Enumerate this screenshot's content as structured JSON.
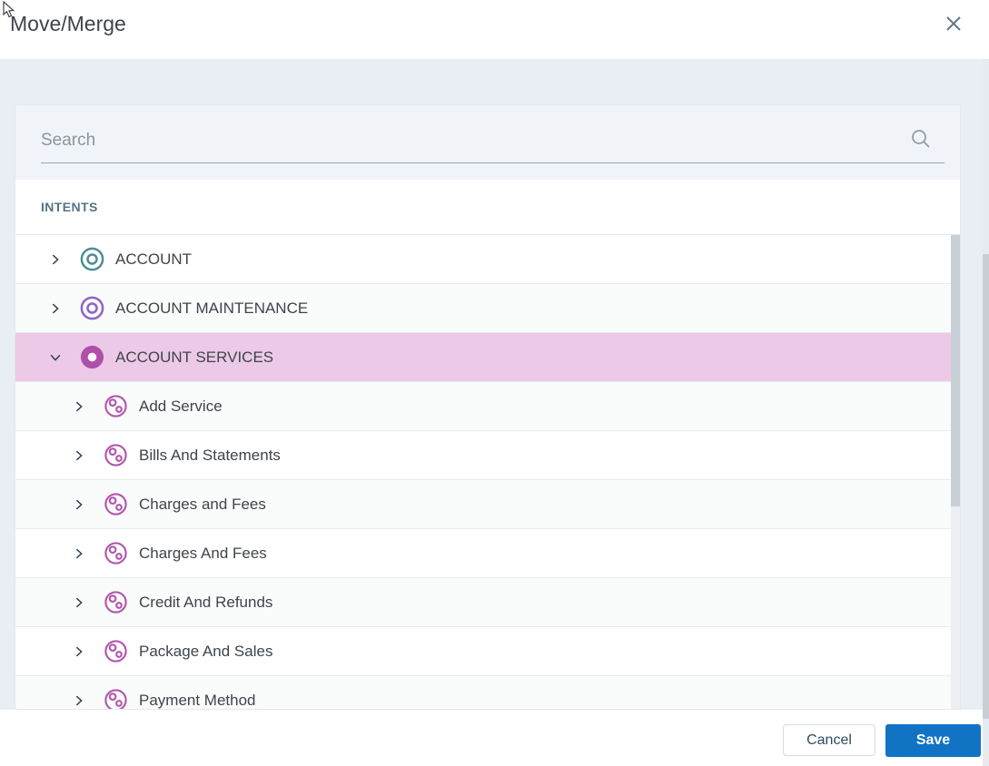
{
  "dialog": {
    "title": "Move/Merge",
    "search": {
      "placeholder": "Search"
    },
    "list_header": "INTENTS",
    "tree": {
      "items": [
        {
          "label": "ACCOUNT",
          "state": "collapsed",
          "color": "#4E8F96"
        },
        {
          "label": "ACCOUNT MAINTENANCE",
          "state": "collapsed",
          "color": "#8E63C8"
        },
        {
          "label": "ACCOUNT SERVICES",
          "state": "expanded",
          "selected": true,
          "color": "#AE4FA9",
          "children": [
            {
              "label": "Add Service",
              "color": "#B156AC"
            },
            {
              "label": "Bills And Statements",
              "color": "#B156AC"
            },
            {
              "label": "Charges and Fees",
              "color": "#B156AC"
            },
            {
              "label": "Charges And Fees",
              "color": "#B156AC"
            },
            {
              "label": "Credit And Refunds",
              "color": "#B156AC"
            },
            {
              "label": "Package And Sales",
              "color": "#B156AC"
            },
            {
              "label": "Payment Method",
              "color": "#B156AC"
            }
          ]
        }
      ]
    },
    "footer": {
      "cancel_label": "Cancel",
      "save_label": "Save"
    },
    "icons": {
      "close": "close-icon",
      "search": "search-icon",
      "chevron_collapsed": "chevron-right-icon",
      "chevron_expanded": "chevron-down-icon"
    },
    "colors": {
      "selected_row_background": "#ECC9E7",
      "save_button_blue": "#1173C4",
      "dialog_body_background": "#E9EEF4",
      "intents_header_text": "#587385"
    }
  }
}
